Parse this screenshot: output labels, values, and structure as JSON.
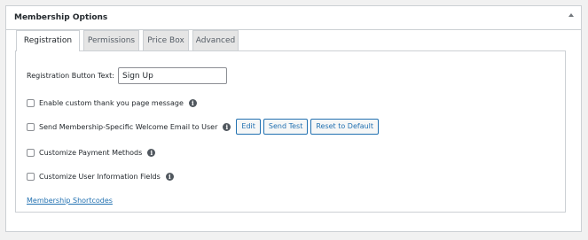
{
  "metabox": {
    "title": "Membership Options"
  },
  "tabs": [
    {
      "label": "Registration"
    },
    {
      "label": "Permissions"
    },
    {
      "label": "Price Box"
    },
    {
      "label": "Advanced"
    }
  ],
  "registration": {
    "button_text_label": "Registration Button Text:",
    "button_text_value": "Sign Up",
    "options": [
      {
        "label": "Enable custom thank you page message",
        "checked": false
      },
      {
        "label": "Send Membership-Specific Welcome Email to User",
        "checked": false
      },
      {
        "label": "Customize Payment Methods",
        "checked": false
      },
      {
        "label": "Customize User Information Fields",
        "checked": false
      }
    ],
    "email_buttons": {
      "edit": "Edit",
      "send_test": "Send Test",
      "reset": "Reset to Default"
    },
    "shortcodes_link": "Membership Shortcodes"
  }
}
